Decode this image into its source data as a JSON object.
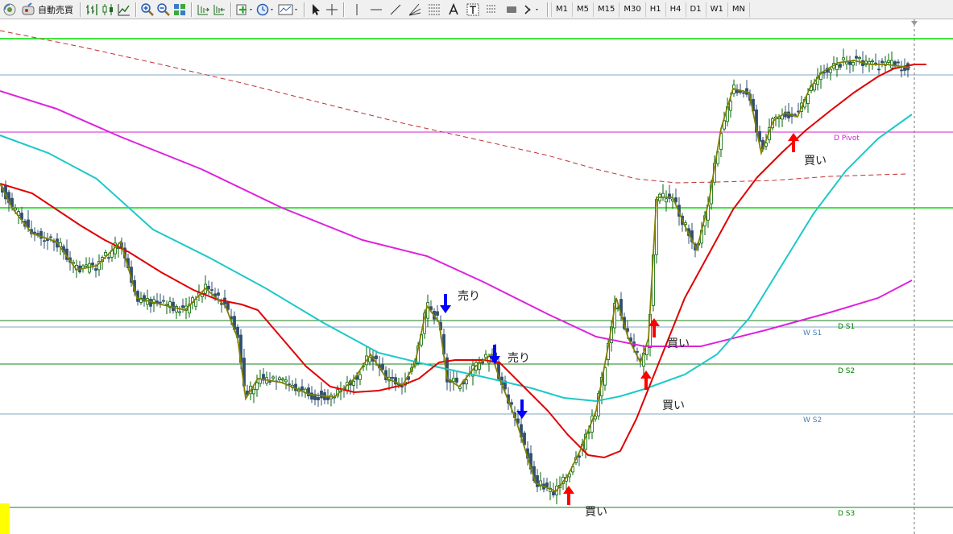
{
  "toolbar": {
    "auto_trading_label": "自動売買",
    "timeframes": [
      "M1",
      "M5",
      "M15",
      "M30",
      "H1",
      "H4",
      "D1",
      "W1",
      "MN"
    ],
    "icons": [
      "signal-icon",
      "auto-trading-icon",
      "bar-chart-icon",
      "candlestick-icon",
      "line-chart-icon",
      "zoom-in-icon",
      "zoom-out-icon",
      "tile-windows-icon",
      "chart-shift-icon",
      "auto-scroll-icon",
      "indicators-icon",
      "periods-clock-icon",
      "templates-icon",
      "cursor-icon",
      "crosshair-icon",
      "vertical-line-icon",
      "horizontal-line-icon",
      "trendline-icon",
      "fibonacci-fan-icon",
      "text-icon",
      "text-label-icon",
      "fibonacci-retracement-icon",
      "rectangle-icon",
      "arrows-menu-icon"
    ]
  },
  "chart": {
    "colors": {
      "background": "#ffffff",
      "bull": "#006400",
      "bear": "#2f4f6f",
      "ma_fast": "#808000",
      "ma_mid": "#e00000",
      "ma_teal": "#1ec8c8",
      "ma_magenta": "#dd22dd",
      "ma_long": "#c03030",
      "green_line": "#00dd00",
      "buy_arrow": "#ff0000",
      "sell_arrow": "#0000ff",
      "pivot_text": "#cc22cc",
      "support_text": "#008000",
      "weekly_text": "#4a80b0"
    },
    "level_labels": {
      "d_pivot": "D Pivot",
      "w_s1": "W S1",
      "d_s1": "D S1",
      "d_s2": "D S2",
      "w_s2": "W S2",
      "d_s3": "D S3"
    },
    "signals": [
      {
        "type": "sell",
        "label": "売り"
      },
      {
        "type": "sell",
        "label": "売り"
      },
      {
        "type": "sell",
        "label": ""
      },
      {
        "type": "buy",
        "label": "買い"
      },
      {
        "type": "buy",
        "label": "買い"
      },
      {
        "type": "buy",
        "label": "買い"
      },
      {
        "type": "buy",
        "label": "買い"
      }
    ]
  }
}
